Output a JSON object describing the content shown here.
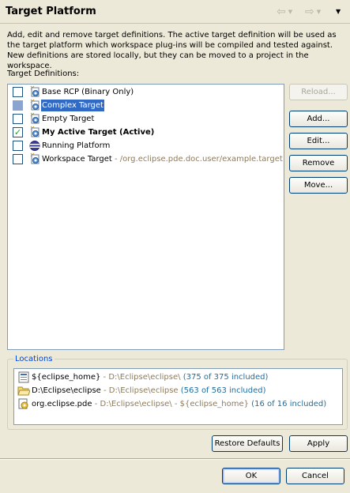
{
  "header": {
    "title": "Target Platform",
    "back_icon": "back-arrow-icon",
    "forward_icon": "forward-arrow-icon",
    "menu_icon": "view-menu-icon"
  },
  "description": "Add, edit and remove target definitions.  The active target definition will be used as the target platform which workspace plug-ins will be compiled and tested against.  New definitions are stored locally, but they can be moved to a project in the workspace.",
  "target_definitions": {
    "label": "Target Definitions:",
    "items": [
      {
        "name": "Base RCP (Binary Only)",
        "location": "",
        "checked": false,
        "selected": false,
        "bold": false,
        "icon": "target-file-icon"
      },
      {
        "name": "Complex Target",
        "location": "",
        "checked": false,
        "selected": true,
        "bold": false,
        "icon": "target-file-icon"
      },
      {
        "name": "Empty Target",
        "location": "",
        "checked": false,
        "selected": false,
        "bold": false,
        "icon": "target-file-icon"
      },
      {
        "name": "My Active Target (Active)",
        "location": "",
        "checked": true,
        "selected": false,
        "bold": true,
        "icon": "target-file-icon"
      },
      {
        "name": "Running Platform",
        "location": "",
        "checked": false,
        "selected": false,
        "bold": false,
        "icon": "running-platform-icon"
      },
      {
        "name": "Workspace Target",
        "location": " - /org.eclipse.pde.doc.user/example.target",
        "checked": false,
        "selected": false,
        "bold": false,
        "icon": "target-file-icon"
      }
    ],
    "check_mark": "✓"
  },
  "buttons": {
    "reload": "Reload...",
    "add": "Add...",
    "edit": "Edit...",
    "remove": "Remove",
    "move": "Move...",
    "restore_defaults": "Restore Defaults",
    "apply": "Apply",
    "ok": "OK",
    "cancel": "Cancel"
  },
  "locations": {
    "label": "Locations",
    "items": [
      {
        "name": "${eclipse_home}",
        "path": " - D:\\Eclipse\\eclipse\\",
        "count": " (375 of 375 included)",
        "icon": "installation-icon"
      },
      {
        "name": "D:\\Eclipse\\eclipse",
        "path": " - D:\\Eclipse\\eclipse",
        "count": " (563 of 563 included)",
        "icon": "folder-icon"
      },
      {
        "name": "org.eclipse.pde",
        "path": " - D:\\Eclipse\\eclipse\\ - ${eclipse_home}",
        "count": " (16 of 16 included)",
        "icon": "feature-icon"
      }
    ]
  }
}
